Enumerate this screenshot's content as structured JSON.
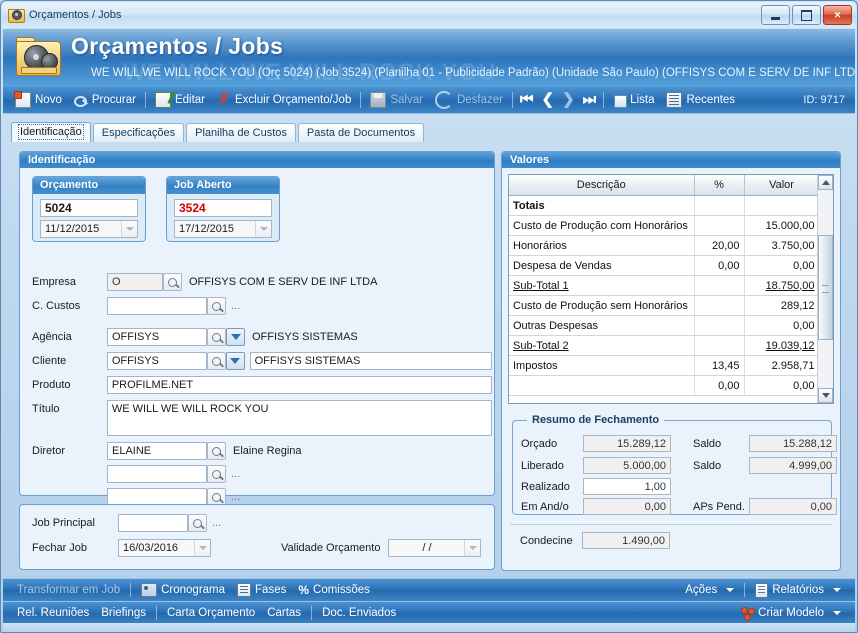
{
  "window": {
    "title": "Orçamentos / Jobs",
    "title_icon": "film-folder-icon",
    "minimize": "minimize-icon",
    "maximize": "maximize-icon",
    "close": "✕"
  },
  "header": {
    "title": "Orçamentos / Jobs",
    "subtitle": "WE WILL WE WILL ROCK YOU (Orç 5024) (Job 3524)  (Planilha 01 - Publicidade Padrão) (Unidade São Paulo) (OFFISYS COM E SERV DE INF LTDA)",
    "watermark": "WE WILL WE WILL ROCK YOU"
  },
  "toolbar": {
    "novo": "Novo",
    "procurar": "Procurar",
    "editar": "Editar",
    "excluir": "Excluir Orçamento/Job",
    "salvar": "Salvar",
    "desfazer": "Desfazer",
    "lista": "Lista",
    "recentes": "Recentes",
    "id": "ID: 9717"
  },
  "tabs": [
    {
      "label": "Identificação",
      "active": true
    },
    {
      "label": "Especificações",
      "active": false
    },
    {
      "label": "Planilha de Custos",
      "active": false
    },
    {
      "label": "Pasta de Documentos",
      "active": false
    }
  ],
  "identificacao": {
    "panel_title": "Identificação",
    "orcamento": {
      "header": "Orçamento",
      "numero": "5024",
      "data": "11/12/2015"
    },
    "job": {
      "header": "Job Aberto",
      "numero": "3524",
      "data": "17/12/2015"
    },
    "empresa": {
      "label": "Empresa",
      "code": "O",
      "desc": "OFFISYS COM E SERV DE INF LTDA"
    },
    "ccustos": {
      "label": "C. Custos",
      "code": "",
      "desc": "..."
    },
    "agencia": {
      "label": "Agência",
      "code": "OFFISYS",
      "desc": "OFFISYS SISTEMAS"
    },
    "cliente": {
      "label": "Cliente",
      "code": "OFFISYS",
      "desc": "OFFISYS SISTEMAS"
    },
    "produto": {
      "label": "Produto",
      "value": "PROFILME.NET"
    },
    "titulo": {
      "label": "Título",
      "value": "WE WILL WE WILL ROCK YOU"
    },
    "diretor": {
      "label": "Diretor",
      "code": "ELAINE",
      "desc": "Elaine Regina"
    },
    "extra1": {
      "code": "",
      "desc": "..."
    },
    "extra2": {
      "code": "",
      "desc": "..."
    }
  },
  "jobbox": {
    "job_principal": {
      "label": "Job Principal",
      "value": "",
      "desc": "..."
    },
    "fechar_job": {
      "label": "Fechar Job",
      "value": "16/03/2016"
    },
    "validade": {
      "label": "Validade Orçamento",
      "value": "/  /"
    }
  },
  "valores": {
    "panel_title": "Valores",
    "columns": [
      "Descrição",
      "%",
      "Valor"
    ],
    "rows": [
      {
        "desc": "Totais",
        "pct": "",
        "val": "",
        "bold": true,
        "underline": false
      },
      {
        "desc": "Custo de Produção com Honorários",
        "pct": "",
        "val": "15.000,00",
        "bold": false,
        "underline": false
      },
      {
        "desc": "Honorários",
        "pct": "20,00",
        "val": "3.750,00",
        "bold": false,
        "underline": false
      },
      {
        "desc": "Despesa de Vendas",
        "pct": "0,00",
        "val": "0,00",
        "bold": false,
        "underline": false
      },
      {
        "desc": "Sub-Total 1",
        "pct": "",
        "val": "18.750,00",
        "bold": false,
        "underline": true
      },
      {
        "desc": "Custo de Produção sem Honorários",
        "pct": "",
        "val": "289,12",
        "bold": false,
        "underline": false
      },
      {
        "desc": "Outras Despesas",
        "pct": "",
        "val": "0,00",
        "bold": false,
        "underline": false
      },
      {
        "desc": "Sub-Total 2",
        "pct": "",
        "val": "19.039,12",
        "bold": false,
        "underline": true
      },
      {
        "desc": "Impostos",
        "pct": "13,45",
        "val": "2.958,71",
        "bold": false,
        "underline": false
      },
      {
        "desc": "",
        "pct": "0,00",
        "val": "0,00",
        "bold": false,
        "underline": false
      }
    ]
  },
  "resumo": {
    "title": "Resumo de Fechamento",
    "orcado_label": "Orçado",
    "orcado_value": "15.289,12",
    "saldo1_label": "Saldo",
    "saldo1_value": "15.288,12",
    "liberado_label": "Liberado",
    "liberado_value": "5.000,00",
    "saldo2_label": "Saldo",
    "saldo2_value": "4.999,00",
    "realizado_label": "Realizado",
    "realizado_value": "1,00",
    "andamento_label": "Em And/o",
    "andamento_value": "0,00",
    "aps_label": "APs Pend.",
    "aps_value": "0,00",
    "condecine_label": "Condecine",
    "condecine_value": "1.490,00"
  },
  "bottom_bar_1": {
    "transformar": "Transformar em Job",
    "cronograma": "Cronograma",
    "fases": "Fases",
    "comissoes": "Comissões",
    "acoes": "Ações",
    "relatorios": "Relatórios"
  },
  "bottom_bar_2": {
    "rel_reunioes": "Rel. Reuniões",
    "briefings": "Briefings",
    "carta_orcamento": "Carta Orçamento",
    "cartas": "Cartas",
    "doc_enviados": "Doc. Enviados",
    "criar_modelo": "Criar Modelo"
  },
  "colors": {
    "accent": "#2f74ba",
    "panel_bg": "#eaf3fb",
    "alert_red": "#d40000"
  }
}
